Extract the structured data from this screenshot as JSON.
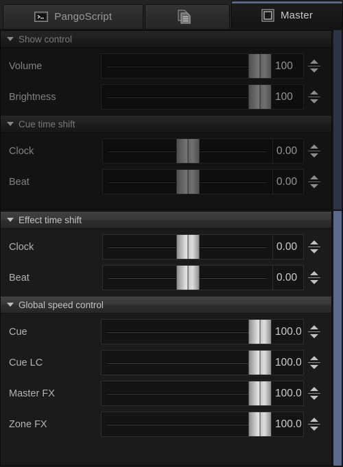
{
  "window": {
    "title": "Master"
  },
  "tabs": [
    {
      "id": "pangoscript",
      "label": "PangoScript",
      "icon": "terminal-icon",
      "active": false
    },
    {
      "id": "documents",
      "label": "",
      "icon": "documents-icon",
      "active": false
    },
    {
      "id": "master",
      "label": "Master",
      "icon": "square-outline-icon",
      "active": true
    }
  ],
  "sections": [
    {
      "id": "show-control",
      "title": "Show control",
      "expanded": true,
      "state": "inactive",
      "rows": [
        {
          "id": "volume",
          "label": "Volume",
          "value": "100",
          "percent": 100,
          "style": "fill"
        },
        {
          "id": "brightness",
          "label": "Brightness",
          "value": "100",
          "percent": 100,
          "style": "fill"
        }
      ]
    },
    {
      "id": "cue-time-shift",
      "title": "Cue time shift",
      "expanded": true,
      "state": "inactive",
      "rows": [
        {
          "id": "cue-clock",
          "label": "Clock",
          "value": "0.00",
          "percent": 50,
          "style": "center"
        },
        {
          "id": "cue-beat",
          "label": "Beat",
          "value": "0.00",
          "percent": 50,
          "style": "center"
        }
      ]
    },
    {
      "id": "effect-time-shift",
      "title": "Effect time shift",
      "expanded": true,
      "state": "active",
      "rows": [
        {
          "id": "effect-clock",
          "label": "Clock",
          "value": "0.00",
          "percent": 50,
          "style": "center"
        },
        {
          "id": "effect-beat",
          "label": "Beat",
          "value": "0.00",
          "percent": 50,
          "style": "center"
        }
      ]
    },
    {
      "id": "global-speed-control",
      "title": "Global speed control",
      "expanded": true,
      "state": "active",
      "rows": [
        {
          "id": "cue",
          "label": "Cue",
          "value": "100.0",
          "percent": 100,
          "style": "fill"
        },
        {
          "id": "cue-lc",
          "label": "Cue LC",
          "value": "100.0",
          "percent": 100,
          "style": "fill"
        },
        {
          "id": "master-fx",
          "label": "Master FX",
          "value": "100.0",
          "percent": 100,
          "style": "fill"
        },
        {
          "id": "zone-fx",
          "label": "Zone FX",
          "value": "100.0",
          "percent": 100,
          "style": "fill"
        }
      ]
    }
  ],
  "scrollbars": [
    {
      "id": "upper-scrollbar",
      "color": "#2c3448"
    },
    {
      "id": "lower-scrollbar",
      "color": "#5a6a8c"
    }
  ],
  "colors": {
    "accent": "#5a6a8c",
    "panel_bg": "#1b1b1b",
    "window_bg": "#151515",
    "text": "#b3b3b3"
  }
}
